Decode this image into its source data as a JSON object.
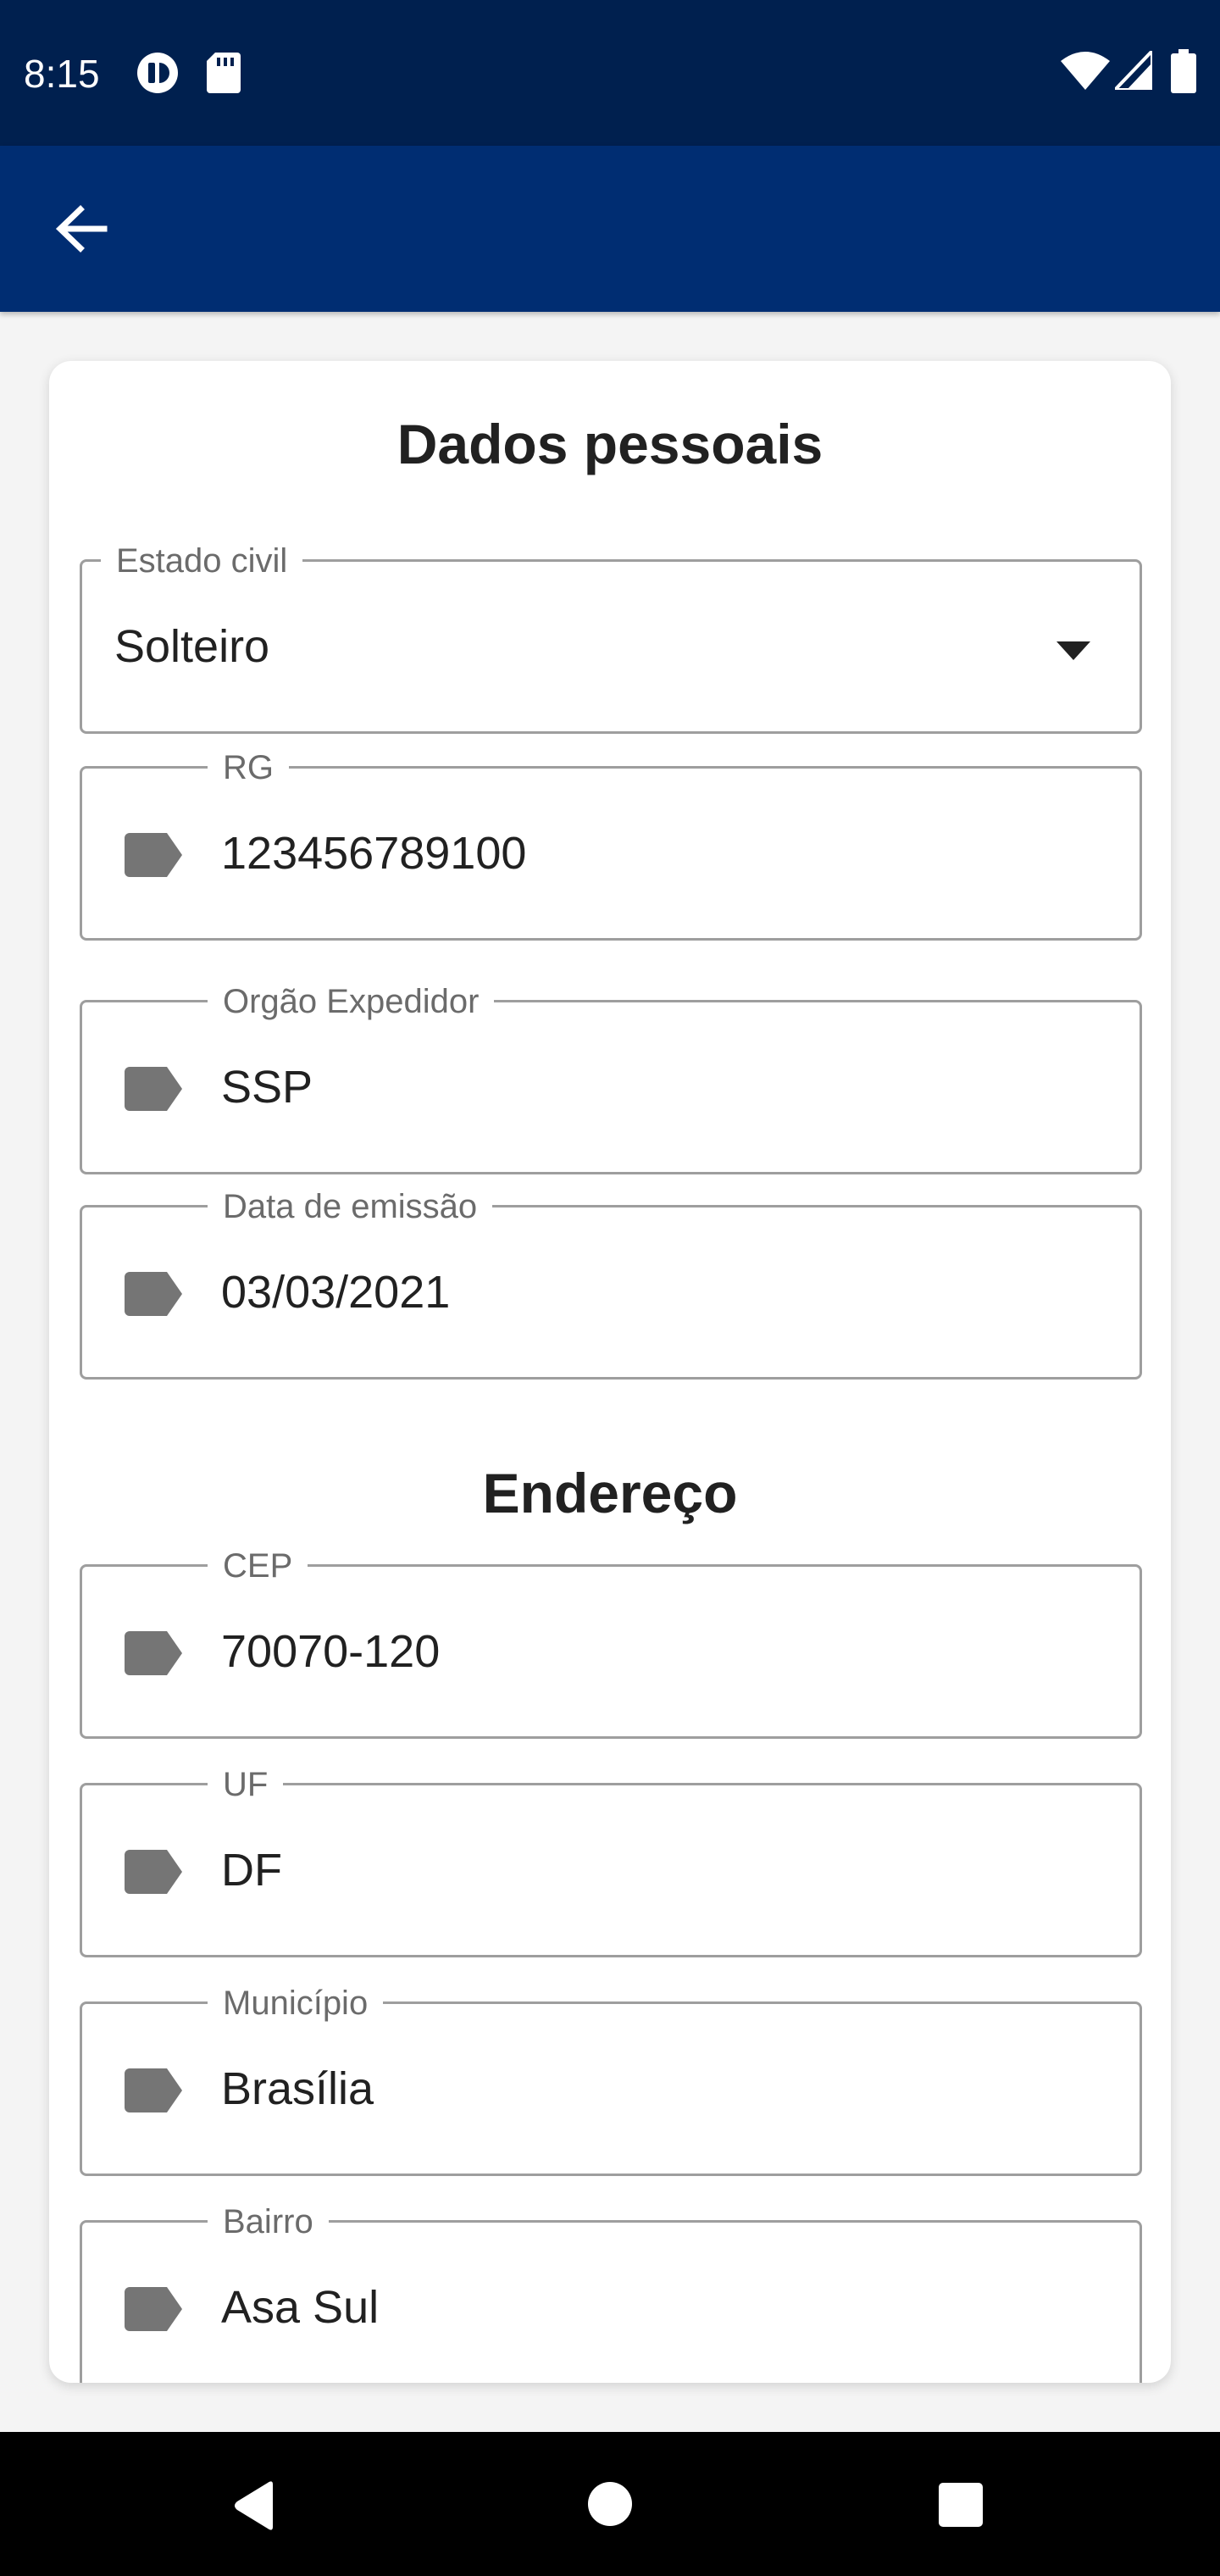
{
  "status_bar": {
    "time": "8:15",
    "left_icons": [
      "data-saver-icon",
      "sd-card-icon"
    ],
    "right_icons": [
      "wifi-icon",
      "signal-icon",
      "battery-icon"
    ]
  },
  "app_bar": {
    "back_icon": "arrow-back-icon"
  },
  "personal_data": {
    "title": "Dados pessoais",
    "marital_status": {
      "label": "Estado civil",
      "value": "Solteiro"
    },
    "rg": {
      "label": "RG",
      "value": "123456789100"
    },
    "issuer": {
      "label": "Orgão Expedidor",
      "value": "SSP"
    },
    "issue_date": {
      "label": "Data de emissão",
      "value": "03/03/2021"
    }
  },
  "address": {
    "title": "Endereço",
    "cep": {
      "label": "CEP",
      "value": "70070-120"
    },
    "uf": {
      "label": "UF",
      "value": "DF"
    },
    "municipio": {
      "label": "Município",
      "value": "Brasília"
    },
    "bairro": {
      "label": "Bairro",
      "value": "Asa Sul"
    }
  },
  "nav_bar": {
    "icons": [
      "back-triangle-icon",
      "home-circle-icon",
      "recents-square-icon"
    ]
  },
  "colors": {
    "status_bar": "#00204f",
    "app_bar": "#002d72",
    "field_border": "#9e9e9e",
    "field_icon": "#757575"
  }
}
